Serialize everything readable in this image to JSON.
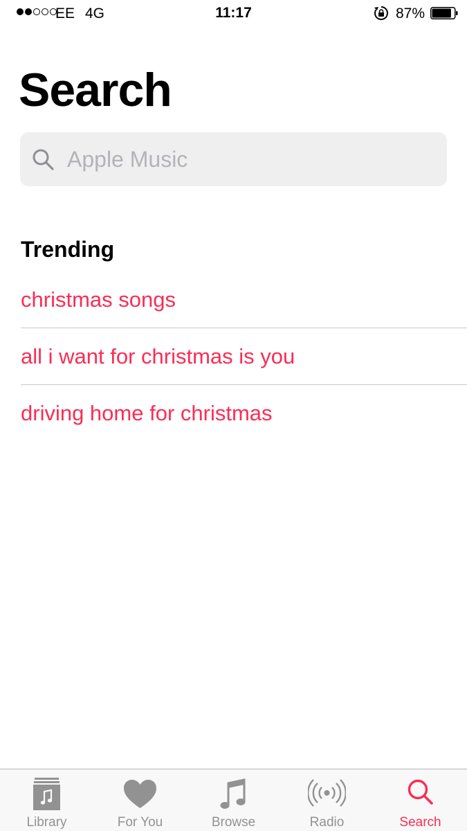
{
  "status_bar": {
    "carrier": "EE",
    "network": "4G",
    "time": "11:17",
    "battery_percent": "87%",
    "battery_level": 0.87,
    "signal_bars_filled": 2,
    "signal_bars_total": 5
  },
  "page": {
    "title": "Search"
  },
  "search": {
    "placeholder": "Apple Music",
    "value": ""
  },
  "trending": {
    "title": "Trending",
    "items": [
      "christmas songs",
      "all i want for christmas is you",
      "driving home for christmas"
    ]
  },
  "tab_bar": {
    "tabs": [
      {
        "label": "Library",
        "icon": "library-icon"
      },
      {
        "label": "For You",
        "icon": "heart-icon"
      },
      {
        "label": "Browse",
        "icon": "music-note-icon"
      },
      {
        "label": "Radio",
        "icon": "radio-icon"
      },
      {
        "label": "Search",
        "icon": "search-icon"
      }
    ],
    "active": "Search"
  },
  "colors": {
    "accent": "#fa2d55",
    "inactive_tab": "#929292",
    "search_field_bg": "#efeff0",
    "placeholder": "#b3b3b8"
  }
}
